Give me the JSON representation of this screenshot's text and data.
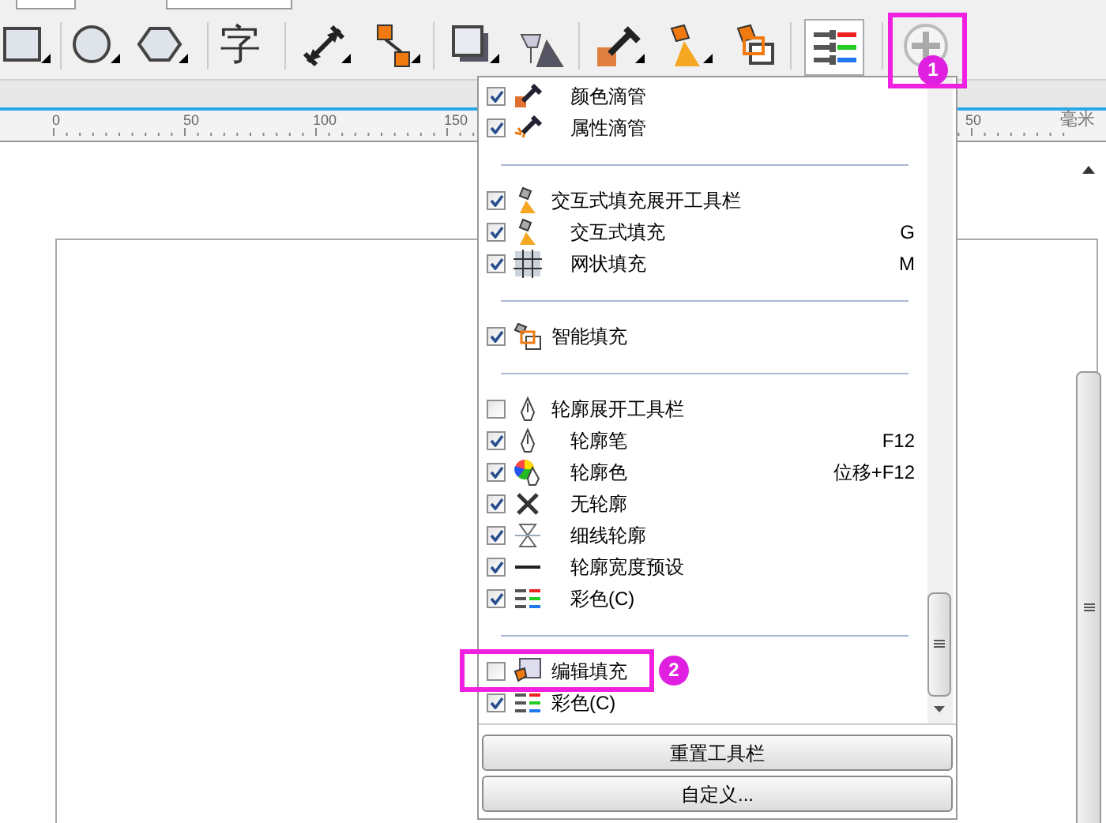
{
  "toolbar": {
    "text_tool_glyph": "字"
  },
  "ruler": {
    "labels": [
      "0",
      "50",
      "100",
      "150",
      "50"
    ],
    "unit": "毫米"
  },
  "menu": {
    "groups": [
      {
        "items": [
          {
            "label": "颜色滴管",
            "checked": true,
            "kind": "sub"
          },
          {
            "label": "属性滴管",
            "checked": true,
            "kind": "sub"
          }
        ]
      },
      {
        "items": [
          {
            "label": "交互式填充展开工具栏",
            "checked": true,
            "kind": "top",
            "children": [
              {
                "label": "交互式填充",
                "checked": true,
                "kind": "sub",
                "shortcut": "G"
              },
              {
                "label": "网状填充",
                "checked": true,
                "kind": "sub",
                "shortcut": "M"
              }
            ]
          }
        ]
      },
      {
        "items": [
          {
            "label": "智能填充",
            "checked": true,
            "kind": "top"
          }
        ]
      },
      {
        "items": [
          {
            "label": "轮廓展开工具栏",
            "checked": false,
            "kind": "top",
            "children": [
              {
                "label": "轮廓笔",
                "checked": true,
                "kind": "sub",
                "shortcut": "F12"
              },
              {
                "label": "轮廓色",
                "checked": true,
                "kind": "sub",
                "shortcut": "位移+F12"
              },
              {
                "label": "无轮廓",
                "checked": true,
                "kind": "sub"
              },
              {
                "label": "细线轮廓",
                "checked": true,
                "kind": "sub"
              },
              {
                "label": "轮廓宽度预设",
                "checked": true,
                "kind": "sub"
              },
              {
                "label": "彩色(C)",
                "checked": true,
                "kind": "sub"
              }
            ]
          }
        ]
      },
      {
        "items": [
          {
            "label": "编辑填充",
            "checked": false,
            "kind": "top"
          },
          {
            "label": "彩色(C)",
            "checked": true,
            "kind": "top"
          }
        ]
      }
    ],
    "buttons": [
      "重置工具栏",
      "自定义..."
    ]
  },
  "callouts": [
    {
      "number": "1"
    },
    {
      "number": "2"
    }
  ]
}
